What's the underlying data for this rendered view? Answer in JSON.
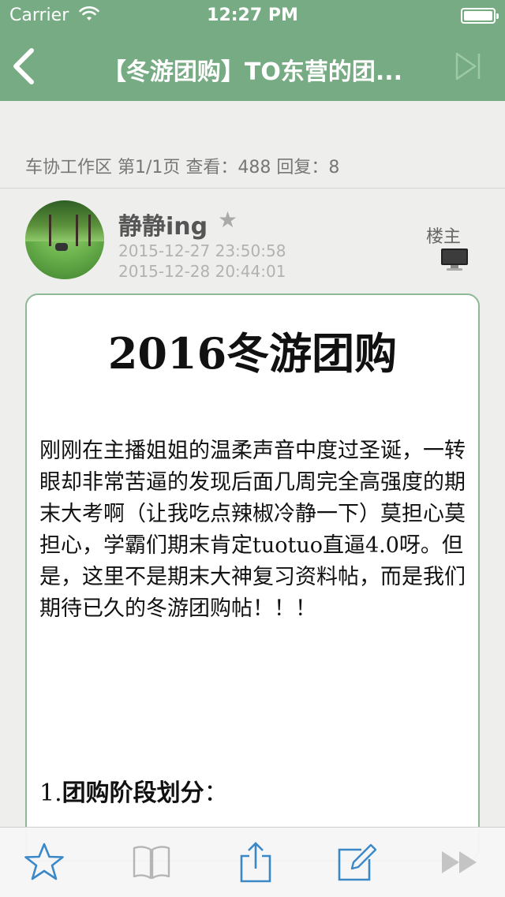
{
  "status_bar": {
    "carrier": "Carrier",
    "time": "12:27 PM"
  },
  "nav": {
    "title": "【冬游团购】TO东营的团..."
  },
  "thread": {
    "info": "车协工作区 第1/1页 查看：488 回复：8"
  },
  "post": {
    "author": "静静ing",
    "star": "★",
    "posted_time": "2015-12-27 23:50:58",
    "edited_time": "2015-12-28 20:44:01",
    "floor_label": "楼主",
    "heading": "2016冬游团购",
    "body": "刚刚在主播姐姐的温柔声音中度过圣诞，一转眼却非常苦逼的发现后面几周完全高强度的期末大考啊（让我吃点辣椒冷静一下）莫担心莫担心，学霸们期末肯定tuotuo直逼4.0呀。但是，这里不是期末大神复习资料帖，而是我们期待已久的冬游团购帖！！！",
    "section_number": "1.",
    "section_title": "团购阶段划分",
    "section_colon": "："
  },
  "toolbar": {
    "items": [
      "star-icon",
      "book-icon",
      "share-icon",
      "edit-icon",
      "next-icon"
    ]
  },
  "colors": {
    "nav": "#77ab83",
    "accent": "#3a88c8",
    "card_border": "#8fb897"
  }
}
